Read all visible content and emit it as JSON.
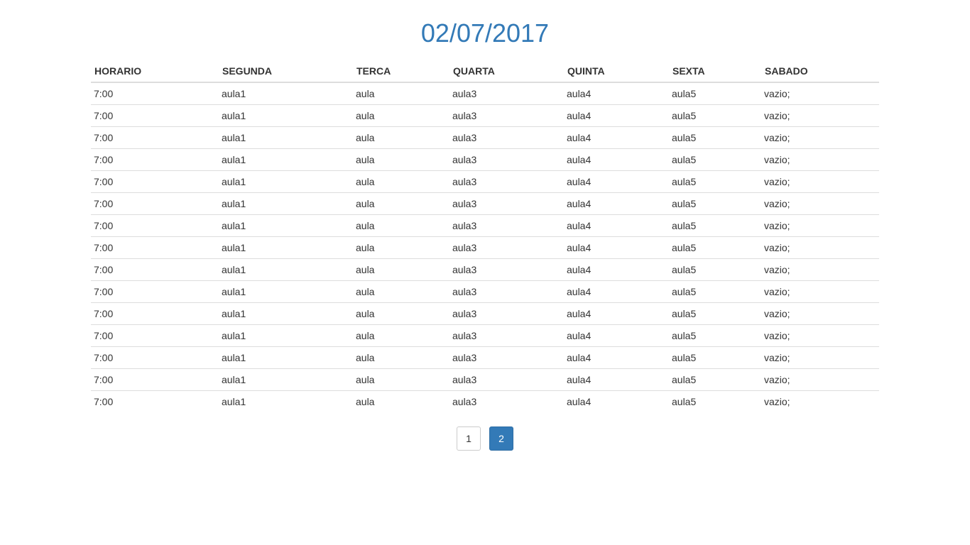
{
  "title": "02/07/2017",
  "table": {
    "headers": [
      "HORARIO",
      "SEGUNDA",
      "TERCA",
      "QUARTA",
      "QUINTA",
      "SEXTA",
      "SABADO"
    ],
    "rows": [
      [
        "7:00",
        "aula1",
        "aula",
        "aula3",
        "aula4",
        "aula5",
        "vazio;"
      ],
      [
        "7:00",
        "aula1",
        "aula",
        "aula3",
        "aula4",
        "aula5",
        "vazio;"
      ],
      [
        "7:00",
        "aula1",
        "aula",
        "aula3",
        "aula4",
        "aula5",
        "vazio;"
      ],
      [
        "7:00",
        "aula1",
        "aula",
        "aula3",
        "aula4",
        "aula5",
        "vazio;"
      ],
      [
        "7:00",
        "aula1",
        "aula",
        "aula3",
        "aula4",
        "aula5",
        "vazio;"
      ],
      [
        "7:00",
        "aula1",
        "aula",
        "aula3",
        "aula4",
        "aula5",
        "vazio;"
      ],
      [
        "7:00",
        "aula1",
        "aula",
        "aula3",
        "aula4",
        "aula5",
        "vazio;"
      ],
      [
        "7:00",
        "aula1",
        "aula",
        "aula3",
        "aula4",
        "aula5",
        "vazio;"
      ],
      [
        "7:00",
        "aula1",
        "aula",
        "aula3",
        "aula4",
        "aula5",
        "vazio;"
      ],
      [
        "7:00",
        "aula1",
        "aula",
        "aula3",
        "aula4",
        "aula5",
        "vazio;"
      ],
      [
        "7:00",
        "aula1",
        "aula",
        "aula3",
        "aula4",
        "aula5",
        "vazio;"
      ],
      [
        "7:00",
        "aula1",
        "aula",
        "aula3",
        "aula4",
        "aula5",
        "vazio;"
      ],
      [
        "7:00",
        "aula1",
        "aula",
        "aula3",
        "aula4",
        "aula5",
        "vazio;"
      ],
      [
        "7:00",
        "aula1",
        "aula",
        "aula3",
        "aula4",
        "aula5",
        "vazio;"
      ],
      [
        "7:00",
        "aula1",
        "aula",
        "aula3",
        "aula4",
        "aula5",
        "vazio;"
      ]
    ]
  },
  "pagination": {
    "pages": [
      "1",
      "2"
    ],
    "active": "2"
  },
  "colors": {
    "accent": "#337ab7",
    "text": "#333333",
    "border": "#dddddd"
  }
}
